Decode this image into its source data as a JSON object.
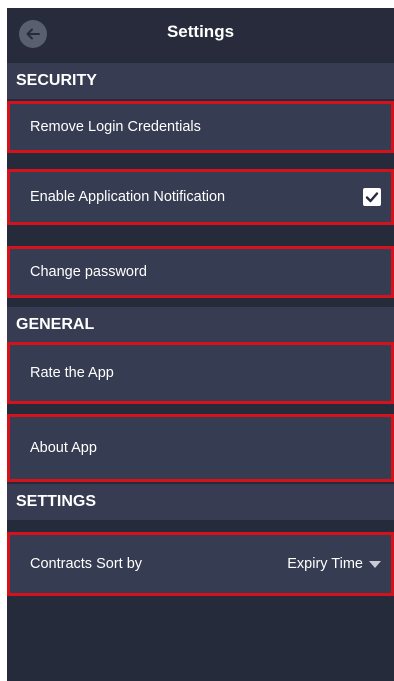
{
  "header": {
    "title": "Settings",
    "back_icon": "back-arrow-icon"
  },
  "sections": {
    "security": "SECURITY",
    "general": "GENERAL",
    "settings": "SETTINGS"
  },
  "security_items": {
    "remove_credentials": "Remove Login Credentials",
    "enable_notifications": "Enable Application Notification",
    "notifications_checked": true,
    "change_password": "Change password"
  },
  "general_items": {
    "rate_app": "Rate the App",
    "about_app": "About App"
  },
  "settings_items": {
    "sort_label": "Contracts Sort by",
    "sort_value": "Expiry Time"
  },
  "colors": {
    "background": "#262b3c",
    "section_header": "#373c52",
    "row": "#363c51",
    "highlight_border": "#d4121c"
  }
}
